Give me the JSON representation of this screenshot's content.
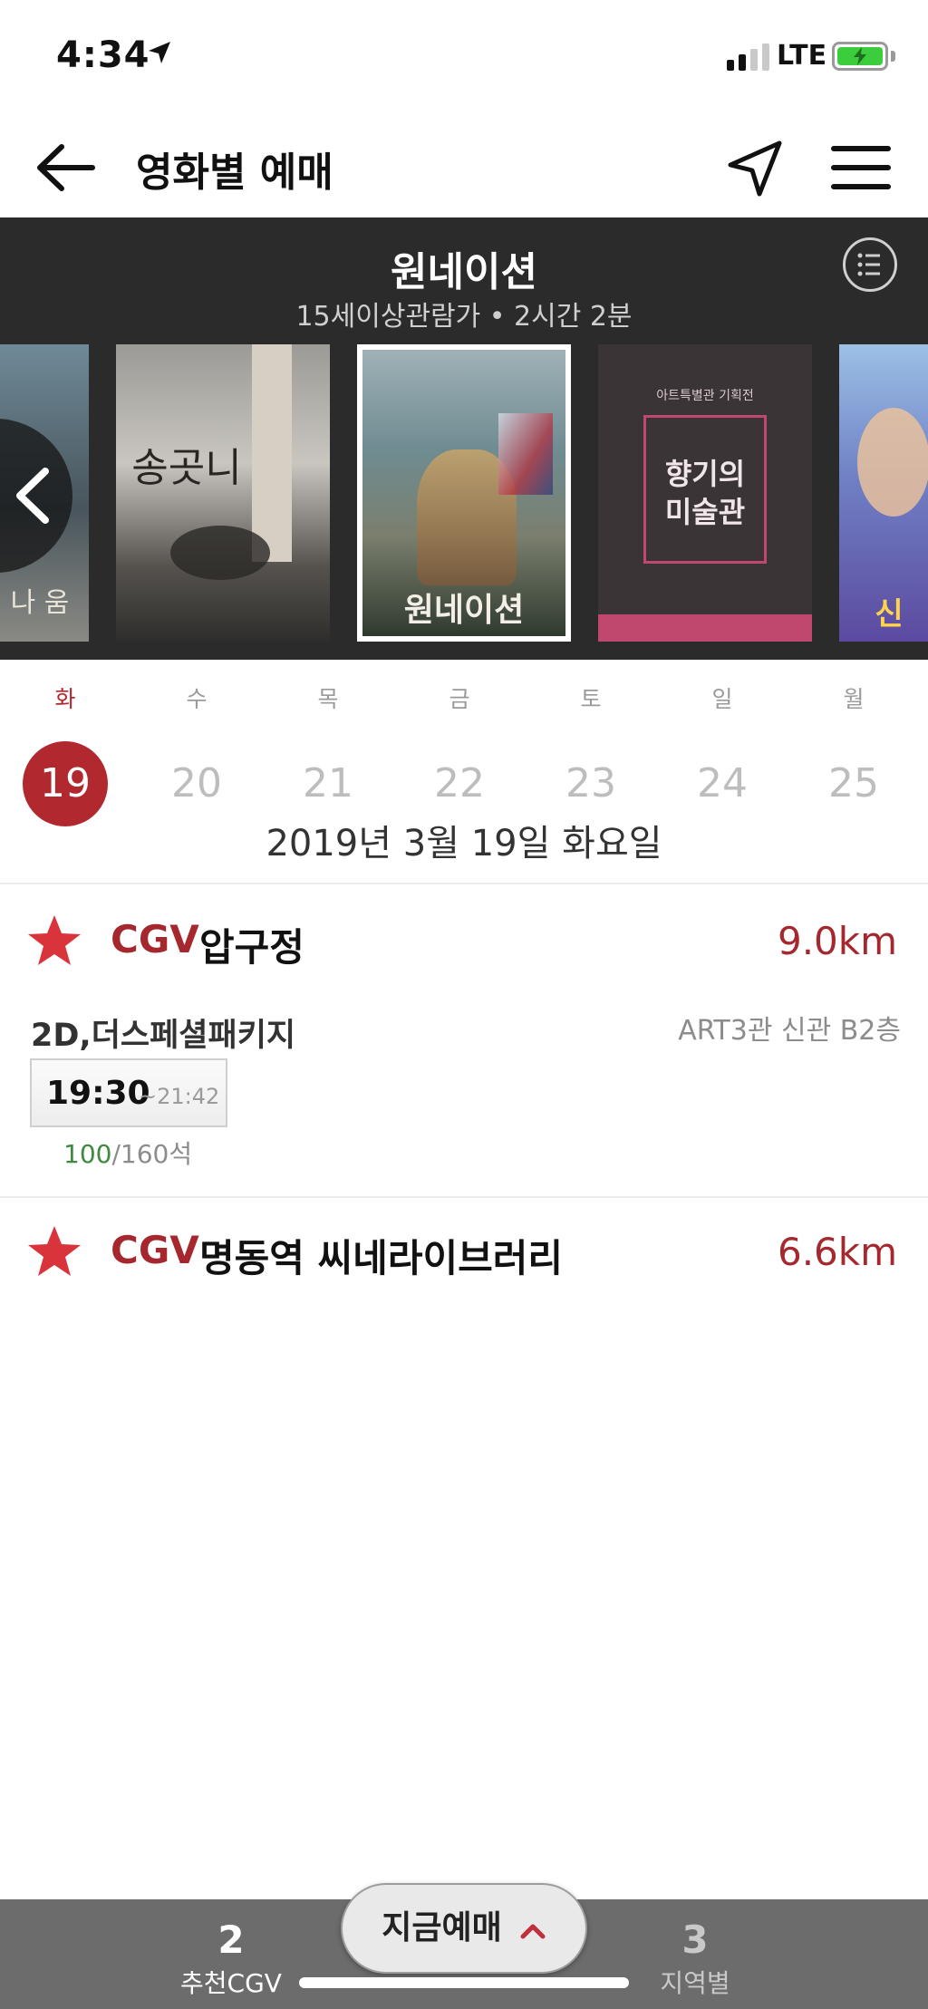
{
  "status_bar": {
    "time": "4:34",
    "network": "LTE"
  },
  "header": {
    "title": "영화별 예매"
  },
  "movie": {
    "title": "원네이션",
    "info": "15세이상관람가 • 2시간 2분"
  },
  "posters": [
    {
      "title": "나 움"
    },
    {
      "title": "송곳니"
    },
    {
      "title": "원네이션",
      "selected": true
    },
    {
      "title": "향기의 미술관",
      "subtitle": "아트특별관 기획전",
      "label_line1": "향기의",
      "label_line2": "미술관"
    },
    {
      "title": "신"
    }
  ],
  "dates": [
    {
      "day": "화",
      "num": "19",
      "selected": true
    },
    {
      "day": "수",
      "num": "20"
    },
    {
      "day": "목",
      "num": "21"
    },
    {
      "day": "금",
      "num": "22"
    },
    {
      "day": "토",
      "num": "23"
    },
    {
      "day": "일",
      "num": "24"
    },
    {
      "day": "월",
      "num": "25"
    }
  ],
  "selected_date": "2019년 3월 19일 화요일",
  "theaters": [
    {
      "brand": "CGV",
      "name": "압구정",
      "distance": "9.0km",
      "format": "2D,더스페셜패키지",
      "screen": "ART3관 신관 B2층",
      "showtime": {
        "start": "19:30",
        "end": "~21:42"
      },
      "seats_available": "100",
      "seats_total": "/160석"
    },
    {
      "brand": "CGV",
      "name": "명동역 씨네라이브러리",
      "distance": "6.6km"
    }
  ],
  "bottom_bar": {
    "left_tab": {
      "count": "2",
      "label": "추천CGV"
    },
    "book_now": "지금예매",
    "right_tab": {
      "count": "3",
      "label": "지역별"
    }
  },
  "colors": {
    "accent": "#b1282e",
    "dark_section": "#2b2b2b",
    "bottom_bar": "#6c6c6c",
    "available_seats": "#3f8a3f"
  },
  "icons": [
    "back-arrow-icon",
    "location-arrow-icon",
    "hamburger-menu-icon",
    "list-icon",
    "chevron-left-icon",
    "star-icon",
    "chevron-up-icon"
  ]
}
